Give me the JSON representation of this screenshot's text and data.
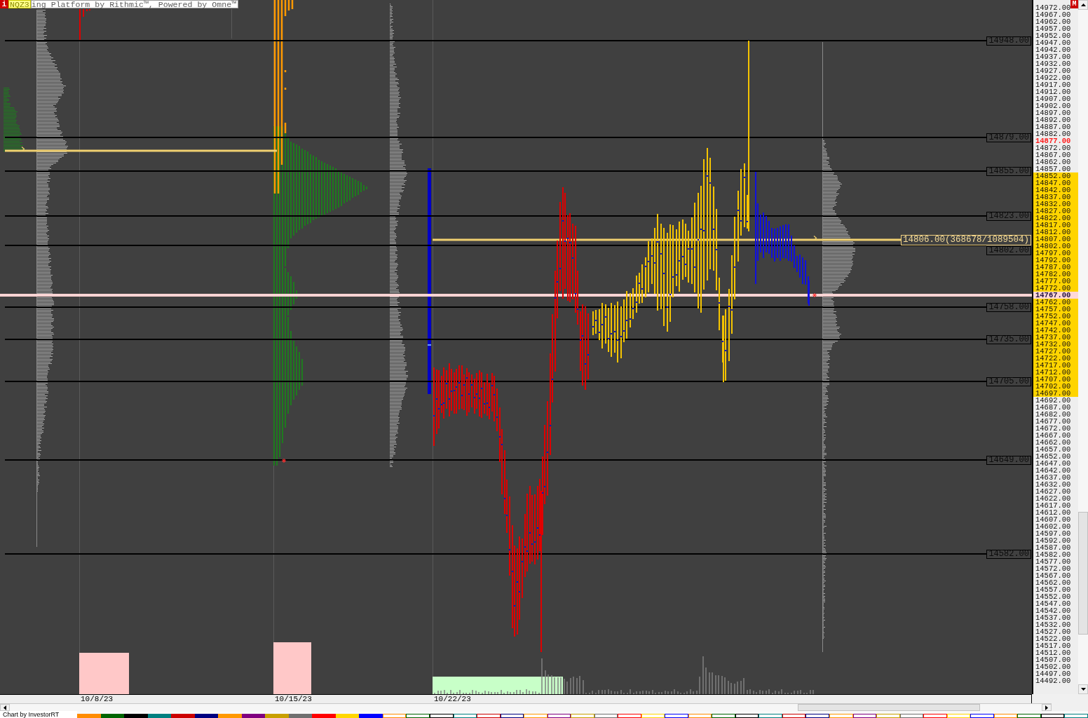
{
  "title_bar": {
    "info_icon": "i",
    "symbol": "NQZ3",
    "caption": "ing Platform by Rithmic™, Powered by Omne™"
  },
  "chart": {
    "levels": [
      "14948.00",
      "14879.00",
      "14855.00",
      "14823.00",
      "14802.00",
      "14758.00",
      "14735.00",
      "14705.00",
      "14649.00",
      "14582.00"
    ],
    "poc_label": "14806.00(368678/1089504)"
  },
  "price_axis": {
    "badge": "M",
    "ticks": [
      {
        "label": "14972.00",
        "kind": "plain"
      },
      {
        "label": "14967.00",
        "kind": "plain"
      },
      {
        "label": "14962.00",
        "kind": "plain"
      },
      {
        "label": "14957.00",
        "kind": "plain"
      },
      {
        "label": "14952.00",
        "kind": "plain"
      },
      {
        "label": "14947.00",
        "kind": "plain"
      },
      {
        "label": "14942.00",
        "kind": "plain"
      },
      {
        "label": "14937.00",
        "kind": "plain"
      },
      {
        "label": "14932.00",
        "kind": "plain"
      },
      {
        "label": "14927.00",
        "kind": "plain"
      },
      {
        "label": "14922.00",
        "kind": "plain"
      },
      {
        "label": "14917.00",
        "kind": "plain"
      },
      {
        "label": "14912.00",
        "kind": "plain"
      },
      {
        "label": "14907.00",
        "kind": "plain"
      },
      {
        "label": "14902.00",
        "kind": "plain"
      },
      {
        "label": "14897.00",
        "kind": "plain"
      },
      {
        "label": "14892.00",
        "kind": "plain"
      },
      {
        "label": "14887.00",
        "kind": "plain"
      },
      {
        "label": "14882.00",
        "kind": "plain"
      },
      {
        "label": "14877.00",
        "kind": "last"
      },
      {
        "label": "14872.00",
        "kind": "plain"
      },
      {
        "label": "14867.00",
        "kind": "plain"
      },
      {
        "label": "14862.00",
        "kind": "plain"
      },
      {
        "label": "14857.00",
        "kind": "plain"
      },
      {
        "label": "14852.00",
        "kind": "value-area"
      },
      {
        "label": "14847.00",
        "kind": "value-area"
      },
      {
        "label": "14842.00",
        "kind": "value-area"
      },
      {
        "label": "14837.00",
        "kind": "value-area"
      },
      {
        "label": "14832.00",
        "kind": "value-area"
      },
      {
        "label": "14827.00",
        "kind": "value-area"
      },
      {
        "label": "14822.00",
        "kind": "value-area"
      },
      {
        "label": "14817.00",
        "kind": "value-area"
      },
      {
        "label": "14812.00",
        "kind": "value-area"
      },
      {
        "label": "14807.00",
        "kind": "value-area"
      },
      {
        "label": "14802.00",
        "kind": "value-area"
      },
      {
        "label": "14797.00",
        "kind": "value-area"
      },
      {
        "label": "14792.00",
        "kind": "value-area"
      },
      {
        "label": "14787.00",
        "kind": "value-area"
      },
      {
        "label": "14782.00",
        "kind": "value-area"
      },
      {
        "label": "14777.00",
        "kind": "value-area"
      },
      {
        "label": "14772.00",
        "kind": "value-area"
      },
      {
        "label": "14767.00",
        "kind": "current"
      },
      {
        "label": "14762.00",
        "kind": "value-area"
      },
      {
        "label": "14757.00",
        "kind": "value-area"
      },
      {
        "label": "14752.00",
        "kind": "value-area"
      },
      {
        "label": "14747.00",
        "kind": "value-area"
      },
      {
        "label": "14742.00",
        "kind": "value-area"
      },
      {
        "label": "14737.00",
        "kind": "value-area"
      },
      {
        "label": "14732.00",
        "kind": "value-area"
      },
      {
        "label": "14727.00",
        "kind": "value-area"
      },
      {
        "label": "14722.00",
        "kind": "value-area"
      },
      {
        "label": "14717.00",
        "kind": "value-area"
      },
      {
        "label": "14712.00",
        "kind": "value-area"
      },
      {
        "label": "14707.00",
        "kind": "value-area"
      },
      {
        "label": "14702.00",
        "kind": "value-area"
      },
      {
        "label": "14697.00",
        "kind": "value-area"
      },
      {
        "label": "14692.00",
        "kind": "plain"
      },
      {
        "label": "14687.00",
        "kind": "plain"
      },
      {
        "label": "14682.00",
        "kind": "plain"
      },
      {
        "label": "14677.00",
        "kind": "plain"
      },
      {
        "label": "14672.00",
        "kind": "plain"
      },
      {
        "label": "14667.00",
        "kind": "plain"
      },
      {
        "label": "14662.00",
        "kind": "plain"
      },
      {
        "label": "14657.00",
        "kind": "plain"
      },
      {
        "label": "14652.00",
        "kind": "plain"
      },
      {
        "label": "14647.00",
        "kind": "plain"
      },
      {
        "label": "14642.00",
        "kind": "plain"
      },
      {
        "label": "14637.00",
        "kind": "plain"
      },
      {
        "label": "14632.00",
        "kind": "plain"
      },
      {
        "label": "14627.00",
        "kind": "plain"
      },
      {
        "label": "14622.00",
        "kind": "plain"
      },
      {
        "label": "14617.00",
        "kind": "plain"
      },
      {
        "label": "14612.00",
        "kind": "plain"
      },
      {
        "label": "14607.00",
        "kind": "plain"
      },
      {
        "label": "14602.00",
        "kind": "plain"
      },
      {
        "label": "14597.00",
        "kind": "plain"
      },
      {
        "label": "14592.00",
        "kind": "plain"
      },
      {
        "label": "14587.00",
        "kind": "plain"
      },
      {
        "label": "14582.00",
        "kind": "plain"
      },
      {
        "label": "14577.00",
        "kind": "plain"
      },
      {
        "label": "14572.00",
        "kind": "plain"
      },
      {
        "label": "14567.00",
        "kind": "plain"
      },
      {
        "label": "14562.00",
        "kind": "plain"
      },
      {
        "label": "14557.00",
        "kind": "plain"
      },
      {
        "label": "14552.00",
        "kind": "plain"
      },
      {
        "label": "14547.00",
        "kind": "plain"
      },
      {
        "label": "14542.00",
        "kind": "plain"
      },
      {
        "label": "14537.00",
        "kind": "plain"
      },
      {
        "label": "14532.00",
        "kind": "plain"
      },
      {
        "label": "14527.00",
        "kind": "plain"
      },
      {
        "label": "14522.00",
        "kind": "plain"
      },
      {
        "label": "14517.00",
        "kind": "plain"
      },
      {
        "label": "14512.00",
        "kind": "plain"
      },
      {
        "label": "14507.00",
        "kind": "plain"
      },
      {
        "label": "14502.00",
        "kind": "plain"
      },
      {
        "label": "14497.00",
        "kind": "plain"
      },
      {
        "label": "14492.00",
        "kind": "plain"
      }
    ]
  },
  "date_axis": {
    "labels": [
      "10/8/23",
      "10/15/23",
      "10/22/23"
    ]
  },
  "footer": {
    "credit": "Chart by InvestorRT",
    "palette": [
      {
        "color": "#ff8c00",
        "kind": "filled"
      },
      {
        "color": "#006400",
        "kind": "filled"
      },
      {
        "color": "#000000",
        "kind": "filled"
      },
      {
        "color": "#008080",
        "kind": "filled"
      },
      {
        "color": "#cc0000",
        "kind": "filled"
      },
      {
        "color": "#000080",
        "kind": "filled"
      },
      {
        "color": "#ff9900",
        "kind": "filled"
      },
      {
        "color": "#800080",
        "kind": "filled"
      },
      {
        "color": "#c8a000",
        "kind": "filled"
      },
      {
        "color": "#707070",
        "kind": "filled"
      },
      {
        "color": "#ff0000",
        "kind": "filled"
      },
      {
        "color": "#ffd700",
        "kind": "filled"
      },
      {
        "color": "#0000ff",
        "kind": "filled"
      },
      {
        "color": "#ff8c00",
        "kind": "outlined"
      },
      {
        "color": "#006400",
        "kind": "outlined"
      },
      {
        "color": "#000000",
        "kind": "outlined"
      },
      {
        "color": "#008080",
        "kind": "outlined"
      },
      {
        "color": "#cc0000",
        "kind": "outlined"
      },
      {
        "color": "#000080",
        "kind": "outlined"
      },
      {
        "color": "#ff9900",
        "kind": "outlined"
      },
      {
        "color": "#800080",
        "kind": "outlined"
      },
      {
        "color": "#c8a000",
        "kind": "outlined"
      },
      {
        "color": "#707070",
        "kind": "outlined"
      },
      {
        "color": "#ff0000",
        "kind": "outlined"
      },
      {
        "color": "#ffd700",
        "kind": "outlined"
      },
      {
        "color": "#0000ff",
        "kind": "outlined"
      },
      {
        "color": "#ff8c00",
        "kind": "outlined"
      },
      {
        "color": "#006400",
        "kind": "outlined"
      },
      {
        "color": "#000000",
        "kind": "outlined"
      },
      {
        "color": "#008080",
        "kind": "outlined"
      },
      {
        "color": "#cc0000",
        "kind": "outlined"
      },
      {
        "color": "#000080",
        "kind": "outlined"
      },
      {
        "color": "#ff9900",
        "kind": "outlined"
      },
      {
        "color": "#800080",
        "kind": "outlined"
      },
      {
        "color": "#c8a000",
        "kind": "outlined"
      },
      {
        "color": "#707070",
        "kind": "outlined"
      },
      {
        "color": "#ff0000",
        "kind": "outlined"
      },
      {
        "color": "#ffd700",
        "kind": "outlined"
      },
      {
        "color": "#0000ff",
        "kind": "outlined"
      },
      {
        "color": "#ff8c00",
        "kind": "outlined"
      },
      {
        "color": "#006400",
        "kind": "outlined"
      },
      {
        "color": "#000000",
        "kind": "outlined"
      },
      {
        "color": "#008080",
        "kind": "outlined"
      }
    ]
  }
}
